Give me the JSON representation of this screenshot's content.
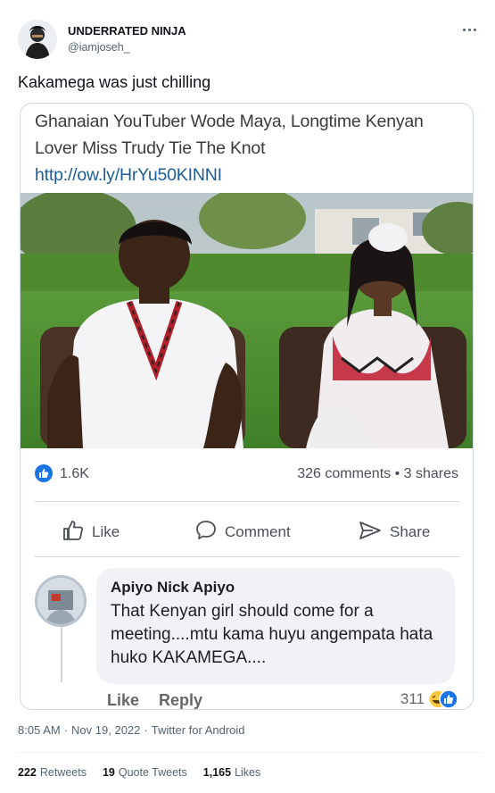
{
  "tweet": {
    "user_name": "UNDERRATED NINJA",
    "user_handle": "@iamjoseh_",
    "text": "Kakamega was just chilling",
    "time": "8:05 AM",
    "date": "Nov 19, 2022",
    "source": "Twitter for Android",
    "stats": {
      "retweets_count": "222",
      "retweets_label": "Retweets",
      "quotes_count": "19",
      "quotes_label": "Quote Tweets",
      "likes_count": "1,165",
      "likes_label": "Likes"
    }
  },
  "fb_post": {
    "headline": "Ghanaian YouTuber Wode Maya, Longtime Kenyan Lover Miss Trudy Tie The Knot",
    "link": "http://ow.ly/HrYu50KINNI",
    "like_count": "1.6K",
    "comments_shares": "326 comments • 3 shares",
    "actions": {
      "like": "Like",
      "comment": "Comment",
      "share": "Share"
    },
    "comment": {
      "name": "Apiyo Nick Apiyo",
      "text": "That Kenyan girl should come for a meeting....mtu kama huyu angempata hata huko KAKAMEGA....",
      "like_label": "Like",
      "reply_label": "Reply",
      "reaction_count": "311"
    }
  },
  "colors": {
    "fb_blue": "#1b74e4",
    "twitter_gray": "#536471",
    "link": "#1c5d99"
  }
}
